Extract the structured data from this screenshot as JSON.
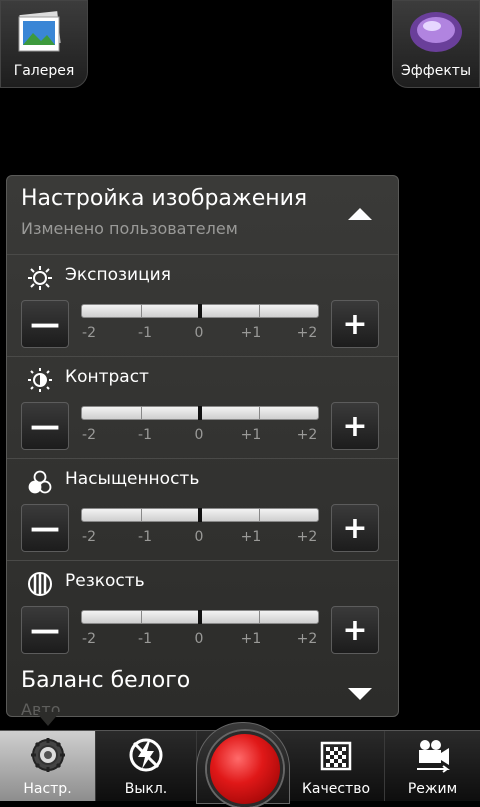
{
  "top": {
    "gallery_label": "Галерея",
    "effects_label": "Эффекты"
  },
  "panel": {
    "title": "Настройка изображения",
    "subtitle": "Изменено пользователем",
    "scale": [
      "-2",
      "-1",
      "0",
      "+1",
      "+2"
    ],
    "settings": [
      {
        "label": "Экспозиция",
        "icon": "sun-icon",
        "value": 0
      },
      {
        "label": "Контраст",
        "icon": "contrast-icon",
        "value": 0
      },
      {
        "label": "Насыщенность",
        "icon": "saturation-icon",
        "value": 0
      },
      {
        "label": "Резкость",
        "icon": "sharpness-icon",
        "value": 0
      }
    ],
    "white_balance_title": "Баланс белого",
    "white_balance_value": "Авто",
    "minus": "—",
    "plus": "+"
  },
  "bottom": {
    "settings_label": "Настр.",
    "flash_label": "Выкл.",
    "quality_label": "Качество",
    "mode_label": "Режим"
  },
  "colors": {
    "shutter": "#e01818",
    "panel_bg": "#333331",
    "accent": "#ffffff"
  }
}
